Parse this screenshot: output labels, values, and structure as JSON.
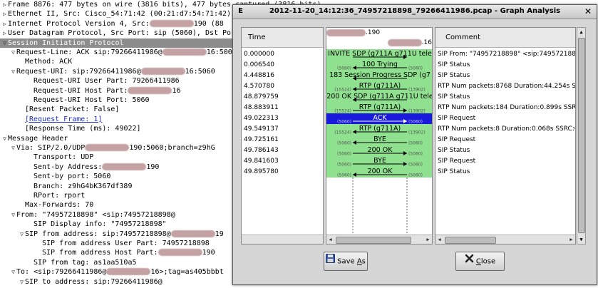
{
  "tree": {
    "rows": [
      {
        "text": "Frame 8876: 477 bytes on wire (3816 bits), 477 bytes captured (3816 bits)",
        "indent": 0,
        "arrow": "right"
      },
      {
        "text": "Ethernet II, Src: Cisco_54:71:42 (00:21:d7:54:71:42)",
        "indent": 0,
        "arrow": "right"
      },
      {
        "text": "Internet Protocol Version 4, Src:",
        "indent": 0,
        "arrow": "right",
        "tail": "190 (88"
      },
      {
        "text": "User Datagram Protocol, Src Port: sip (5060), Dst Por",
        "indent": 0,
        "arrow": "right"
      },
      {
        "text": "Session Initiation Protocol",
        "indent": 0,
        "arrow": "down",
        "selected": true
      },
      {
        "text": "Request-Line: ACK sip:79266411986@",
        "indent": 1,
        "arrow": "down",
        "tail": "16:500"
      },
      {
        "text": "Method: ACK",
        "indent": 2
      },
      {
        "text": "Request-URI: sip:79266411986@",
        "indent": 1,
        "arrow": "down",
        "tail": "16:5060"
      },
      {
        "text": "Request-URI User Part: 79266411986",
        "indent": 3
      },
      {
        "text": "Request-URI Host Part:",
        "indent": 3,
        "tail": "16"
      },
      {
        "text": "Request-URI Host Port: 5060",
        "indent": 3
      },
      {
        "text": "[Resent Packet: False]",
        "indent": 2
      },
      {
        "text": "[Request Frame: 1]",
        "indent": 2,
        "link": true
      },
      {
        "text": "[Response Time (ms): 49022]",
        "indent": 2
      },
      {
        "text": "Message Header",
        "indent": 0,
        "arrow": "down"
      },
      {
        "text": "Via: SIP/2.0/UDP",
        "indent": 1,
        "arrow": "down",
        "tail": "190:5060;branch=z9hG"
      },
      {
        "text": "Transport: UDP",
        "indent": 3
      },
      {
        "text": "Sent-by Address:",
        "indent": 3,
        "tail": "190"
      },
      {
        "text": "Sent-by port: 5060",
        "indent": 3
      },
      {
        "text": "Branch: z9hG4bK367df389",
        "indent": 3
      },
      {
        "text": "RPort: rport",
        "indent": 3
      },
      {
        "text": "Max-Forwards: 70",
        "indent": 2
      },
      {
        "text": "From: \"74957218898\" <sip:74957218898@",
        "indent": 1,
        "arrow": "down"
      },
      {
        "text": "SIP Display info: \"74957218898\"",
        "indent": 3
      },
      {
        "text": "SIP from address: sip:74957218898@",
        "indent": 2,
        "arrow": "down",
        "tail": "19"
      },
      {
        "text": "SIP from address User Part: 74957218898",
        "indent": 4
      },
      {
        "text": "SIP from address Host Part:",
        "indent": 4,
        "tail": "190"
      },
      {
        "text": "SIP from tag: as1aa510a5",
        "indent": 3
      },
      {
        "text": "To: <sip:79266411986@",
        "indent": 1,
        "arrow": "down",
        "tail": "16>;tag=as405bbbt"
      },
      {
        "text": "SIP to address: sip:79266411986@",
        "indent": 2,
        "arrow": "down"
      }
    ]
  },
  "dialog": {
    "menu_glyph": "E",
    "title": "2012-11-20_14:12:36_74957218898_79266411986.pcap - Graph Analysis",
    "close_glyph": "✕",
    "time_header": "Time",
    "comment_header": "Comment",
    "host_a_tail": ".190",
    "host_b_tail": ".16",
    "save_label_prefix": "Save ",
    "save_label_key": "A",
    "save_label_suffix": "s",
    "close_label_key": "C",
    "close_label_suffix": "lose"
  },
  "rows": [
    {
      "time": "0.000000",
      "label": "INVITE SDP (g711A g711U tele",
      "dir": "right",
      "lport": "",
      "rport": "",
      "comment": "SIP From: \"74957218898\" <sip:74957218898@",
      "highlight": false
    },
    {
      "time": "0.006540",
      "label": "100 Trying",
      "dir": "left",
      "lport": "(5060)",
      "rport": "(5060)",
      "comment": "SIP Status",
      "highlight": false
    },
    {
      "time": "4.448816",
      "label": "183 Session Progress SDP (g7",
      "dir": "left",
      "lport": "",
      "rport": "",
      "comment": "SIP Status",
      "highlight": false
    },
    {
      "time": "4.570780",
      "label": "RTP (g711A)",
      "dir": "left",
      "lport": "(15524)",
      "rport": "(13902)",
      "comment": "RTP Num packets:8768  Duration:44.254s SSR",
      "highlight": false
    },
    {
      "time": "48.879759",
      "label": "200 OK SDP (g711A g711U tele",
      "dir": "left",
      "lport": "",
      "rport": "",
      "comment": "SIP Status",
      "highlight": false
    },
    {
      "time": "48.883911",
      "label": "RTP (g711A)",
      "dir": "right",
      "lport": "(15524)",
      "rport": "(13902)",
      "comment": "RTP Num packets:184  Duration:0.899s SSRC:0",
      "highlight": false
    },
    {
      "time": "49.022313",
      "label": "ACK",
      "dir": "right",
      "lport": "(5060)",
      "rport": "(5060)",
      "comment": "SIP Request",
      "highlight": true
    },
    {
      "time": "49.549137",
      "label": "RTP (g711A)",
      "dir": "left",
      "lport": "(15524)",
      "rport": "(13902)",
      "comment": "RTP Num packets:8  Duration:0.068s SSRC:0x6",
      "highlight": false
    },
    {
      "time": "49.725161",
      "label": "BYE",
      "dir": "left",
      "lport": "(5060)",
      "rport": "(5060)",
      "comment": "SIP Request",
      "highlight": false
    },
    {
      "time": "49.786143",
      "label": "200 OK",
      "dir": "right",
      "lport": "(5060)",
      "rport": "(5060)",
      "comment": "SIP Status",
      "highlight": false
    },
    {
      "time": "49.841603",
      "label": "BYE",
      "dir": "right",
      "lport": "(5060)",
      "rport": "(5060)",
      "comment": "SIP Request",
      "highlight": false
    },
    {
      "time": "49.895780",
      "label": "200 OK",
      "dir": "left",
      "lport": "(5060)",
      "rport": "(5060)",
      "comment": "SIP Status",
      "highlight": false
    }
  ],
  "colors": {
    "flow_green": "#8fe08f",
    "highlight_blue": "#1a1adc",
    "selection_gray": "#8c8c8c",
    "redaction": "#c4a2a3"
  }
}
